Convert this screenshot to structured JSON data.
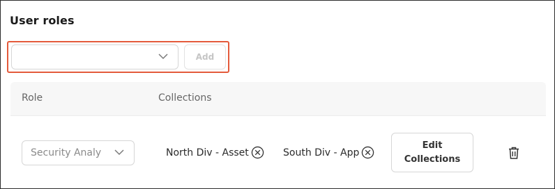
{
  "section": {
    "title": "User roles"
  },
  "add_role": {
    "select_value": "",
    "add_label": "Add"
  },
  "table": {
    "headers": [
      "Role",
      "Collections"
    ],
    "rows": [
      {
        "role": "Security Analy",
        "collections": [
          "North Div - Asset",
          "South Div - App"
        ],
        "edit_label": "Edit Collections"
      }
    ]
  },
  "icons": {
    "dropdown": "chevron-down-icon",
    "remove_chip": "circle-x-icon",
    "delete_row": "trash-icon"
  },
  "colors": {
    "highlight_border": "#e45a3b",
    "header_bg": "#f7f7f7",
    "disabled_text": "#c5c5c5"
  }
}
